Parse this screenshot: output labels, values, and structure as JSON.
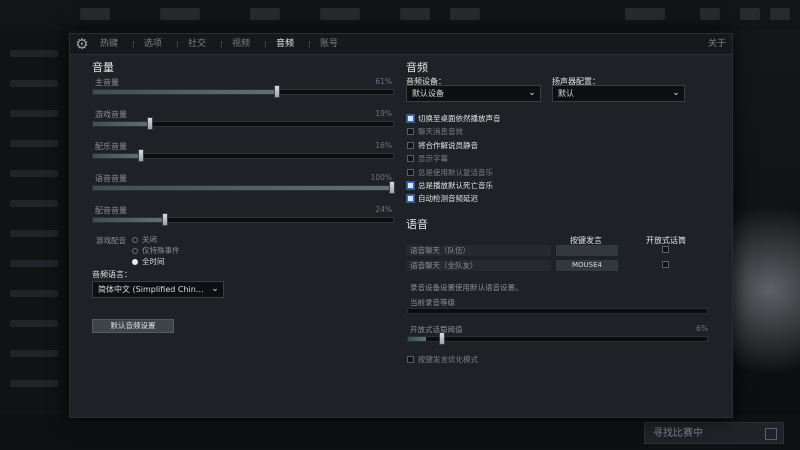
{
  "tabs": [
    "热键",
    "选项",
    "社交",
    "视频",
    "音频",
    "账号"
  ],
  "active_tab": "音频",
  "close_label": "关于",
  "volume": {
    "title": "音量",
    "sliders": [
      {
        "label": "主音量",
        "value_text": "61%",
        "value": 0.61
      },
      {
        "label": "游戏音量",
        "value_text": "19%",
        "value": 0.19
      },
      {
        "label": "配乐音量",
        "value_text": "16%",
        "value": 0.16
      },
      {
        "label": "语音音量",
        "value_text": "100%",
        "value": 1.0
      },
      {
        "label": "配音音量",
        "value_text": "24%",
        "value": 0.24
      }
    ],
    "radio_group_label": "游戏配音",
    "radio_options": [
      "关闭",
      "仅特殊事件",
      "全时间"
    ],
    "radio_selected": 2,
    "language_label": "音频语言：",
    "language_value": "简体中文 (Simplified Chin…",
    "default_button": "默认音频设置"
  },
  "audio": {
    "title": "音频",
    "device_label": "音频设备：",
    "device_value": "默认设备",
    "speaker_label": "扬声器配置：",
    "speaker_value": "默认",
    "checkboxes": [
      {
        "label": "切换至桌面依然播放声音",
        "checked": true
      },
      {
        "label": "聊天消息音效",
        "checked": false
      },
      {
        "label": "将合作解说员静音",
        "checked": false
      },
      {
        "label": "显示字幕",
        "checked": false
      },
      {
        "label": "总是使用默认复活音乐",
        "checked": false
      },
      {
        "label": "总是播放默认死亡音乐",
        "checked": true
      },
      {
        "label": "自动检测音频延迟",
        "checked": true
      }
    ]
  },
  "voice": {
    "title": "语音",
    "col_hotkey": "按键发言",
    "col_openmic": "开放式话筒",
    "rows": [
      {
        "label": "语音聊天（队伍）",
        "hotkey": ""
      },
      {
        "label": "语音聊天（全队友）",
        "hotkey": "MOUSE4"
      }
    ],
    "recording_note": "录音设备设置使用默认语音设置。",
    "current_level_label": "当前录音等级",
    "threshold_label": "开放式话筒阈值",
    "threshold_value_text": "6%",
    "threshold_value": 0.06,
    "optimize_label": "按键发言优化模式"
  },
  "background": {
    "play_button": "寻找比赛中"
  }
}
